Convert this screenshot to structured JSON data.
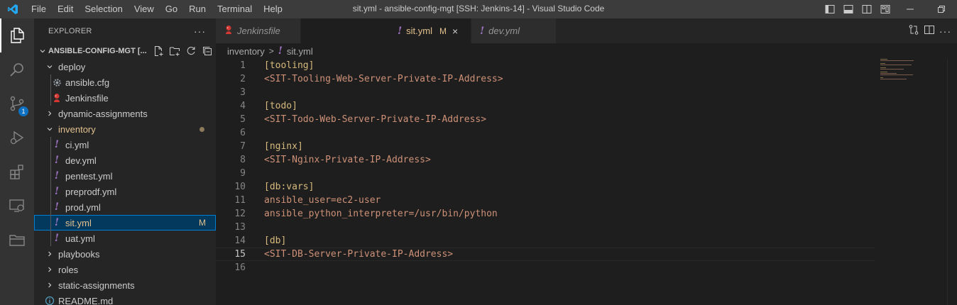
{
  "title_bar": {
    "menu": [
      "File",
      "Edit",
      "Selection",
      "View",
      "Go",
      "Run",
      "Terminal",
      "Help"
    ],
    "window_title": "sit.yml - ansible-config-mgt [SSH: Jenkins-14] - Visual Studio Code"
  },
  "activity_bar": {
    "items": [
      "explorer",
      "search",
      "source-control",
      "run-debug",
      "extensions",
      "remote-explorer",
      "folders"
    ],
    "scm_badge": "1"
  },
  "sidebar": {
    "title": "EXPLORER",
    "more": "···",
    "folder_name": "ANSIBLE-CONFIG-MGT [...",
    "tree": [
      {
        "label": "deploy",
        "type": "folder",
        "expanded": true
      },
      {
        "label": "ansible.cfg",
        "type": "gear"
      },
      {
        "label": "Jenkinsfile",
        "type": "jenkins"
      },
      {
        "label": "dynamic-assignments",
        "type": "folder",
        "expanded": false
      },
      {
        "label": "inventory",
        "type": "folder",
        "expanded": true
      },
      {
        "label": "ci.yml",
        "type": "yml"
      },
      {
        "label": "dev.yml",
        "type": "yml"
      },
      {
        "label": "pentest.yml",
        "type": "yml"
      },
      {
        "label": "preprodf.yml",
        "type": "yml"
      },
      {
        "label": "prod.yml",
        "type": "yml"
      },
      {
        "label": "sit.yml",
        "type": "yml",
        "status": "M"
      },
      {
        "label": "uat.yml",
        "type": "yml"
      },
      {
        "label": "playbooks",
        "type": "folder",
        "expanded": false
      },
      {
        "label": "roles",
        "type": "folder",
        "expanded": false
      },
      {
        "label": "static-assignments",
        "type": "folder",
        "expanded": false
      },
      {
        "label": "README.md",
        "type": "info"
      }
    ]
  },
  "tabs": [
    {
      "label": "Jenkinsfile",
      "icon": "jenkins"
    },
    {
      "label": "sit.yml",
      "icon": "yml",
      "status": "M",
      "close": "×"
    },
    {
      "label": "dev.yml",
      "icon": "yml"
    }
  ],
  "breadcrumb": {
    "folder": "inventory",
    "separator": ">",
    "file": "sit.yml"
  },
  "editor": {
    "current_line": 15,
    "lines": [
      "[tooling]",
      "<SIT-Tooling-Web-Server-Private-IP-Address>",
      "",
      "[todo]",
      "<SIT-Todo-Web-Server-Private-IP-Address>",
      "",
      "[nginx]",
      "<SIT-Nginx-Private-IP-Address>",
      "",
      "[db:vars]",
      "ansible_user=ec2-user",
      "ansible_python_interpreter=/usr/bin/python",
      "",
      "[db]",
      "<SIT-DB-Server-Private-IP-Address>",
      ""
    ]
  },
  "colors": {
    "section": "#d7ba7d",
    "value": "#ce9178",
    "modified": "#e2c08d",
    "yml_icon": "#a074c4",
    "accent": "#007acc"
  }
}
